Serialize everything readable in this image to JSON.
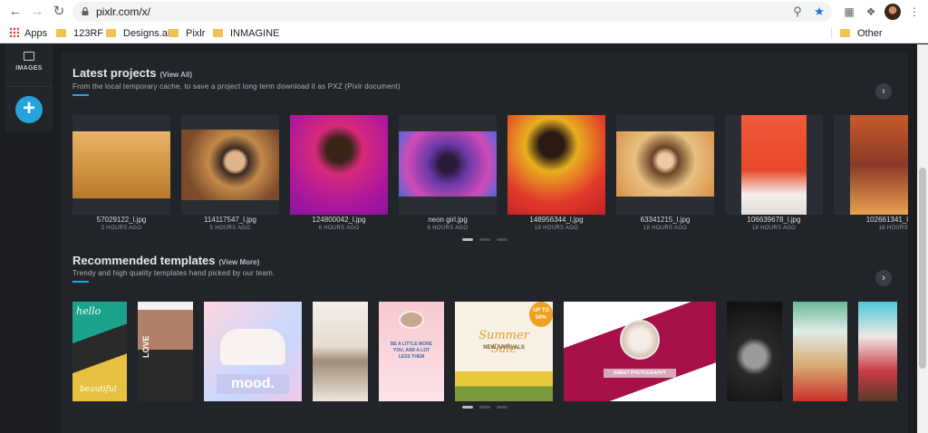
{
  "browser": {
    "url": "pixlr.com/x/",
    "bookmarks": [
      "Apps",
      "123RF",
      "Designs.ai",
      "Pixlr",
      "INMAGINE"
    ],
    "other_bookmarks": "Other bookmarks"
  },
  "sidebar": {
    "images_label": "IMAGES"
  },
  "latest": {
    "title": "Latest projects",
    "link": "(View All)",
    "subtitle": "From the local temporary cache, to save a project long term download it as PXZ (Pixlr document)",
    "projects": [
      {
        "name": "57029122_l.jpg",
        "time": "3 HOURS AGO"
      },
      {
        "name": "114117547_l.jpg",
        "time": "5 HOURS AGO"
      },
      {
        "name": "124800042_l.jpg",
        "time": "6 HOURS AGO"
      },
      {
        "name": "neon girl.jpg",
        "time": "6 HOURS AGO"
      },
      {
        "name": "148956344_l.jpg",
        "time": "18 HOURS AGO"
      },
      {
        "name": "63341215_l.jpg",
        "time": "18 HOURS AGO"
      },
      {
        "name": "106639678_l.jpg",
        "time": "18 HOURS AGO"
      },
      {
        "name": "102661341_l",
        "time": "18 HOURS"
      }
    ]
  },
  "templates": {
    "title": "Recommended templates",
    "link": "(View More)",
    "subtitle": "Trendy and high quality templates hand picked by our team.",
    "items": [
      {
        "text1": "hello",
        "text2": "beautiful"
      },
      {
        "text1": "LOVE"
      },
      {
        "text1": "mood."
      },
      {
        "text1": ""
      },
      {
        "text1": "BE A LITTLE MORE YOU, AND A LOT LESS THEM"
      },
      {
        "text1": "Summer Sale",
        "text2": "NEW ARRIVALS",
        "badge": "UP TO 50%"
      },
      {
        "text1": "SWEET PHOTOGRAPHY"
      },
      {
        "text1": ""
      },
      {
        "text1": ""
      },
      {
        "text1": ""
      }
    ]
  },
  "colors": {
    "accent": "#26a3dc",
    "panel": "#212429",
    "background": "#1b1d21"
  }
}
